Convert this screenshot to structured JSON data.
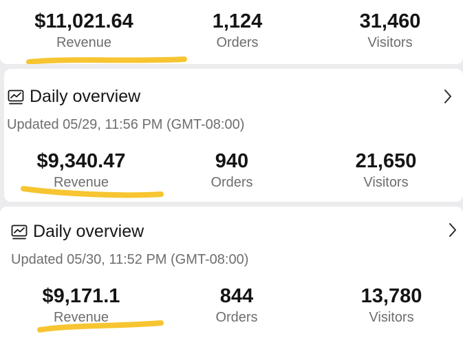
{
  "top_summary": {
    "metrics": [
      {
        "value": "$11,021.64",
        "label": "Revenue"
      },
      {
        "value": "1,124",
        "label": "Orders"
      },
      {
        "value": "31,460",
        "label": "Visitors"
      }
    ]
  },
  "overview_1": {
    "title": "Daily overview",
    "updated": "Updated 05/29, 11:56 PM (GMT-08:00)",
    "metrics": [
      {
        "value": "$9,340.47",
        "label": "Revenue"
      },
      {
        "value": "940",
        "label": "Orders"
      },
      {
        "value": "21,650",
        "label": "Visitors"
      }
    ]
  },
  "overview_2": {
    "title": "Daily overview",
    "updated": "Updated 05/30, 11:52 PM (GMT-08:00)",
    "metrics": [
      {
        "value": "$9,171.1",
        "label": "Revenue"
      },
      {
        "value": "844",
        "label": "Orders"
      },
      {
        "value": "13,780",
        "label": "Visitors"
      }
    ]
  },
  "icons": {
    "chart": "line-chart-icon",
    "chevron": "chevron-right-icon"
  },
  "colors": {
    "highlight": "#f7c531",
    "label": "#6d6d70",
    "value": "#141414",
    "background": "#ececee"
  }
}
